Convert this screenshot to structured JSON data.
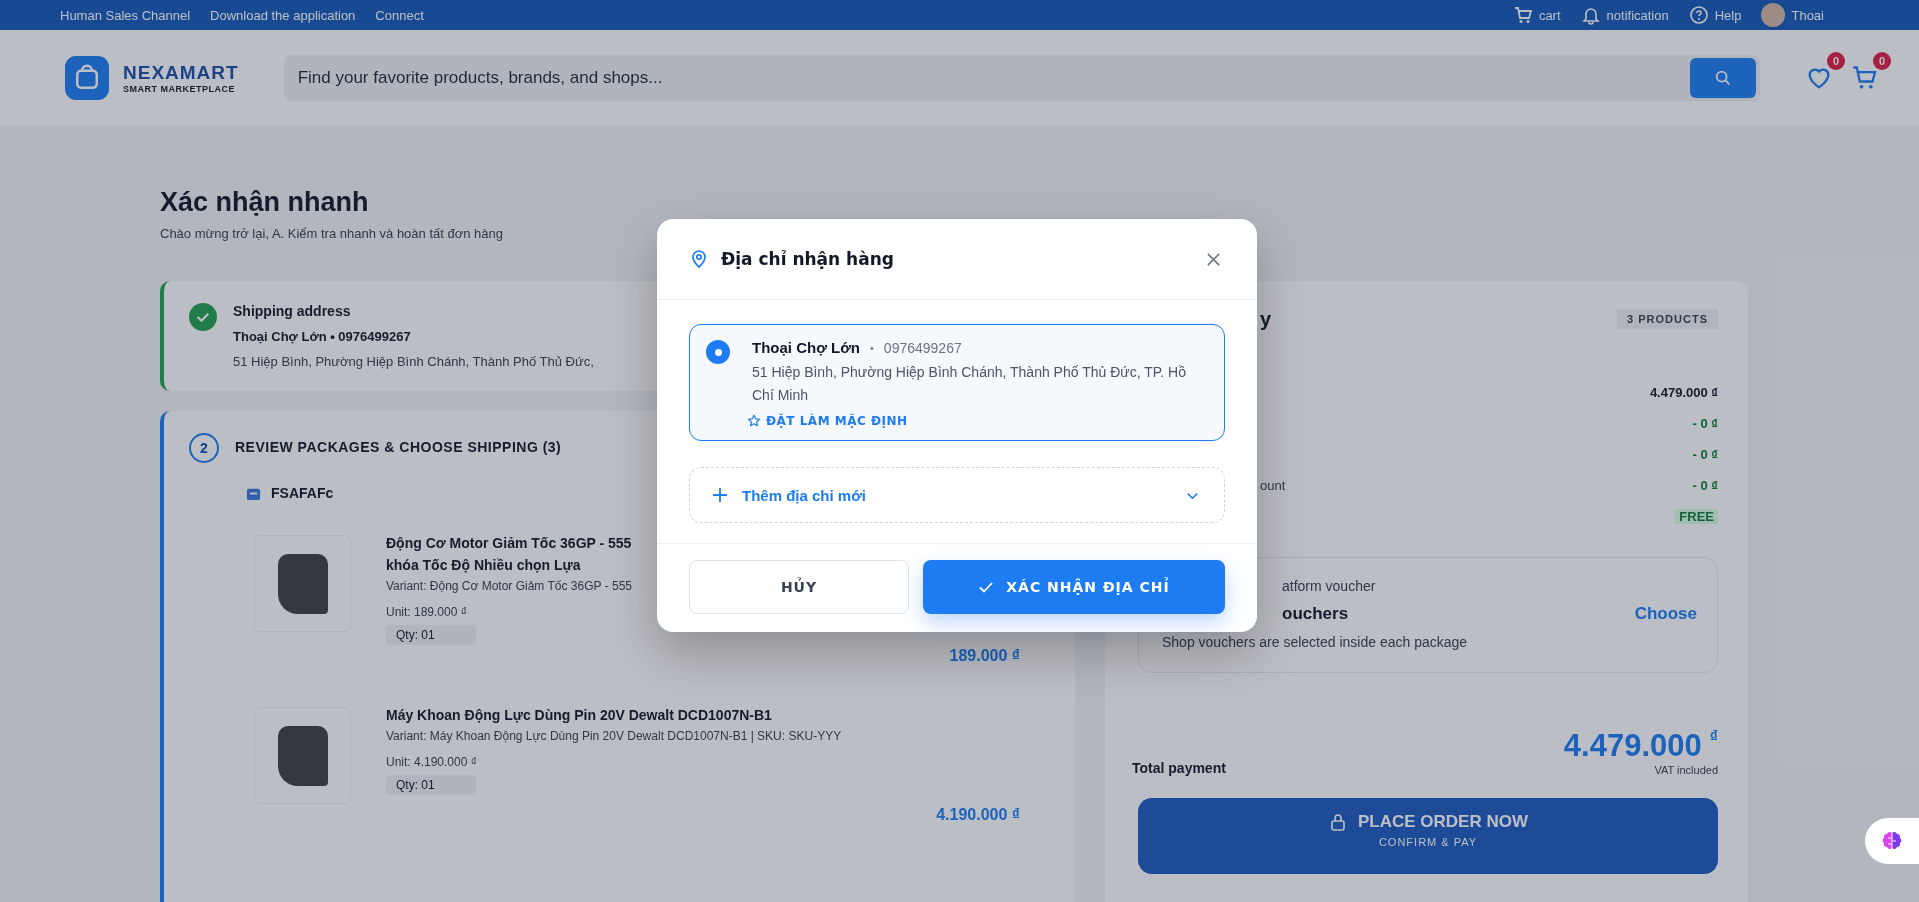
{
  "top_bar": {
    "links": [
      "Human Sales Channel",
      "Download the application",
      "Connect"
    ],
    "actions": [
      {
        "kind": "cart",
        "label": "cart"
      },
      {
        "kind": "bell",
        "label": "notification"
      },
      {
        "kind": "help",
        "label": "Help"
      },
      {
        "kind": "avatar",
        "label": "Thoai"
      }
    ]
  },
  "header": {
    "logo": {
      "name": "NEXAMART",
      "tagline": "SMART MARKETPLACE"
    },
    "search": {
      "placeholder": "Find your favorite products, brands, and shops..."
    },
    "wishlist_badge": "0",
    "cart_badge": "0"
  },
  "page": {
    "title": "Xác nhận nhanh",
    "subtitle": "Chào mừng trở lại, A. Kiểm tra nhanh và hoàn tất đơn hàng"
  },
  "steps": [
    {
      "kind": "done",
      "title": "Shipping address",
      "line": "Thoại Chợ Lớn • 0976499267",
      "detail": "51 Hiệp Bình, Phường Hiệp Bình Chánh, Thành Phố Thủ Đức,"
    },
    {
      "kind": "current",
      "number": "2",
      "title": "REVIEW PACKAGES & CHOOSE SHIPPING (3)",
      "shop": "FSAFAFc",
      "products": [
        {
          "title": "Động Cơ Motor Giảm Tốc 36GP - 555",
          "title_line2": "khóa Tốc Độ Nhiều chọn Lựa",
          "variant": "Variant: Động Cơ Motor Giảm Tốc 36GP - 555",
          "unit": "Unit: 189.000 ₫",
          "qty": "Qty: 01",
          "price": "189.000 ₫"
        },
        {
          "title": "Máy Khoan Động Lực Dùng Pin 20V Dewalt DCD1007N-B1",
          "variant": "Variant: Máy Khoan Động Lực Dùng Pin 20V Dewalt DCD1007N-B1 | SKU: SKU-YYY",
          "unit": "Unit: 4.190.000 ₫",
          "qty": "Qty: 01",
          "price": "4.190.000 ₫"
        }
      ]
    }
  ],
  "summary": {
    "title": "y",
    "count": "3 PRODUCTS",
    "rows": [
      {
        "kind": "amount",
        "value": "4.479.000 ₫"
      },
      {
        "kind": "discount",
        "value": "- 0 ₫"
      },
      {
        "kind": "discount",
        "value": "- 0 ₫"
      },
      {
        "kind": "discount",
        "label": "ount",
        "value": "- 0 ₫"
      },
      {
        "kind": "free",
        "value": "FREE"
      }
    ],
    "voucher": {
      "label": "atform voucher",
      "title": "ouchers",
      "action": "Choose",
      "note": "Shop vouchers are selected inside each package"
    },
    "total_label": "Total payment",
    "total": "4.479.000",
    "currency": "₫",
    "vat": "VAT included",
    "place_order": "PLACE ORDER NOW",
    "place_order_sub": "CONFIRM & PAY"
  },
  "modal": {
    "title": "Địa chỉ nhận hàng",
    "addresses": [
      {
        "name": "Thoại Chợ Lớn",
        "separator": "•",
        "phone": "0976499267",
        "address": "51 Hiệp Bình, Phường Hiệp Bình Chánh, Thành Phố Thủ Đức, TP. Hồ Chí Minh",
        "set_default": "ĐẶT LÀM MẶC ĐỊNH",
        "selected": true
      }
    ],
    "add_new": {
      "label": "Thêm địa chỉ mới",
      "expanded": false
    },
    "cancel": "HỦY",
    "confirm": "XÁC NHẬN ĐỊA CHỈ"
  }
}
